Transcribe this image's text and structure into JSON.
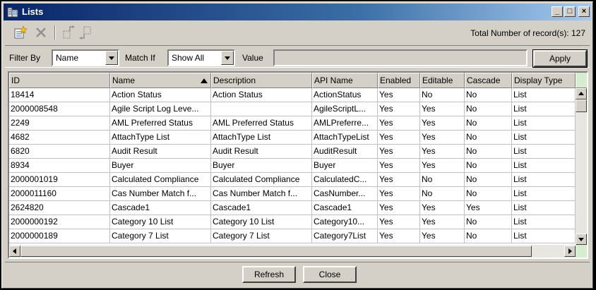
{
  "window": {
    "title": "Lists",
    "minimize_glyph": "_",
    "maximize_glyph": "□",
    "close_glyph": "×"
  },
  "toolbar": {
    "icons": [
      "new-list-icon",
      "delete-icon",
      "move-up-icon",
      "move-down-icon"
    ],
    "record_count": "Total Number of record(s): 127"
  },
  "filter": {
    "filter_by_label": "Filter By",
    "filter_by_value": "Name",
    "match_if_label": "Match If",
    "match_if_value": "Show All",
    "value_label": "Value",
    "value": "",
    "apply_label": "Apply"
  },
  "table": {
    "sorted_column": "Name",
    "columns": [
      "ID",
      "Name",
      "Description",
      "API Name",
      "Enabled",
      "Editable",
      "Cascade",
      "Display Type"
    ],
    "rows": [
      [
        "18414",
        "Action Status",
        "Action Status",
        "ActionStatus",
        "Yes",
        "No",
        "No",
        "List"
      ],
      [
        "2000008548",
        "Agile Script Log Leve...",
        "",
        "AgileScriptL...",
        "Yes",
        "Yes",
        "No",
        "List"
      ],
      [
        "2249",
        "AML Preferred Status",
        "AML Preferred Status",
        "AMLPreferre...",
        "Yes",
        "Yes",
        "No",
        "List"
      ],
      [
        "4682",
        "AttachType List",
        "AttachType List",
        "AttachTypeList",
        "Yes",
        "Yes",
        "No",
        "List"
      ],
      [
        "6820",
        "Audit Result",
        "Audit Result",
        "AuditResult",
        "Yes",
        "Yes",
        "No",
        "List"
      ],
      [
        "8934",
        "Buyer",
        "Buyer",
        "Buyer",
        "Yes",
        "Yes",
        "No",
        "List"
      ],
      [
        "2000001019",
        "Calculated Compliance",
        "Calculated Compliance",
        "CalculatedC...",
        "Yes",
        "No",
        "No",
        "List"
      ],
      [
        "2000011160",
        "Cas Number Match f...",
        "Cas Number Match f...",
        "CasNumber...",
        "Yes",
        "No",
        "No",
        "List"
      ],
      [
        "2624820",
        "Cascade1",
        "Cascade1",
        "Cascade1",
        "Yes",
        "Yes",
        "Yes",
        "List"
      ],
      [
        "2000000192",
        "Category 10 List",
        "Category 10 List",
        "Category10...",
        "Yes",
        "Yes",
        "No",
        "List"
      ],
      [
        "2000000189",
        "Category 7 List",
        "Category 7 List",
        "Category7List",
        "Yes",
        "Yes",
        "No",
        "List"
      ]
    ]
  },
  "footer": {
    "refresh_label": "Refresh",
    "close_label": "Close"
  },
  "colors": {
    "title_gradient_start": "#0a246a",
    "title_gradient_end": "#a6caf0",
    "face": "#d4d0c8",
    "header_fill": "#d8ecd0"
  }
}
